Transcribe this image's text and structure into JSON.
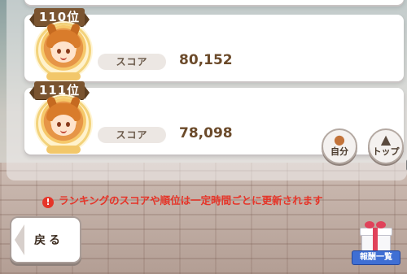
{
  "ranking": {
    "entries": [
      {
        "rank": "110位",
        "score_label": "スコア",
        "score": "80,152"
      },
      {
        "rank": "111位",
        "score_label": "スコア",
        "score": "78,098"
      }
    ]
  },
  "actions": {
    "self_label": "自分",
    "top_label": "トップ"
  },
  "notice": {
    "text": "ランキングのスコアや順位は一定時間ごとに更新されます"
  },
  "footer": {
    "back_label": "戻る",
    "rewards_label": "報酬一覧"
  },
  "colors": {
    "rank_ribbon": "#7a5430",
    "score_text": "#6b4a2a",
    "notice_red": "#e53428",
    "reward_blue": "#3f6fd4"
  }
}
